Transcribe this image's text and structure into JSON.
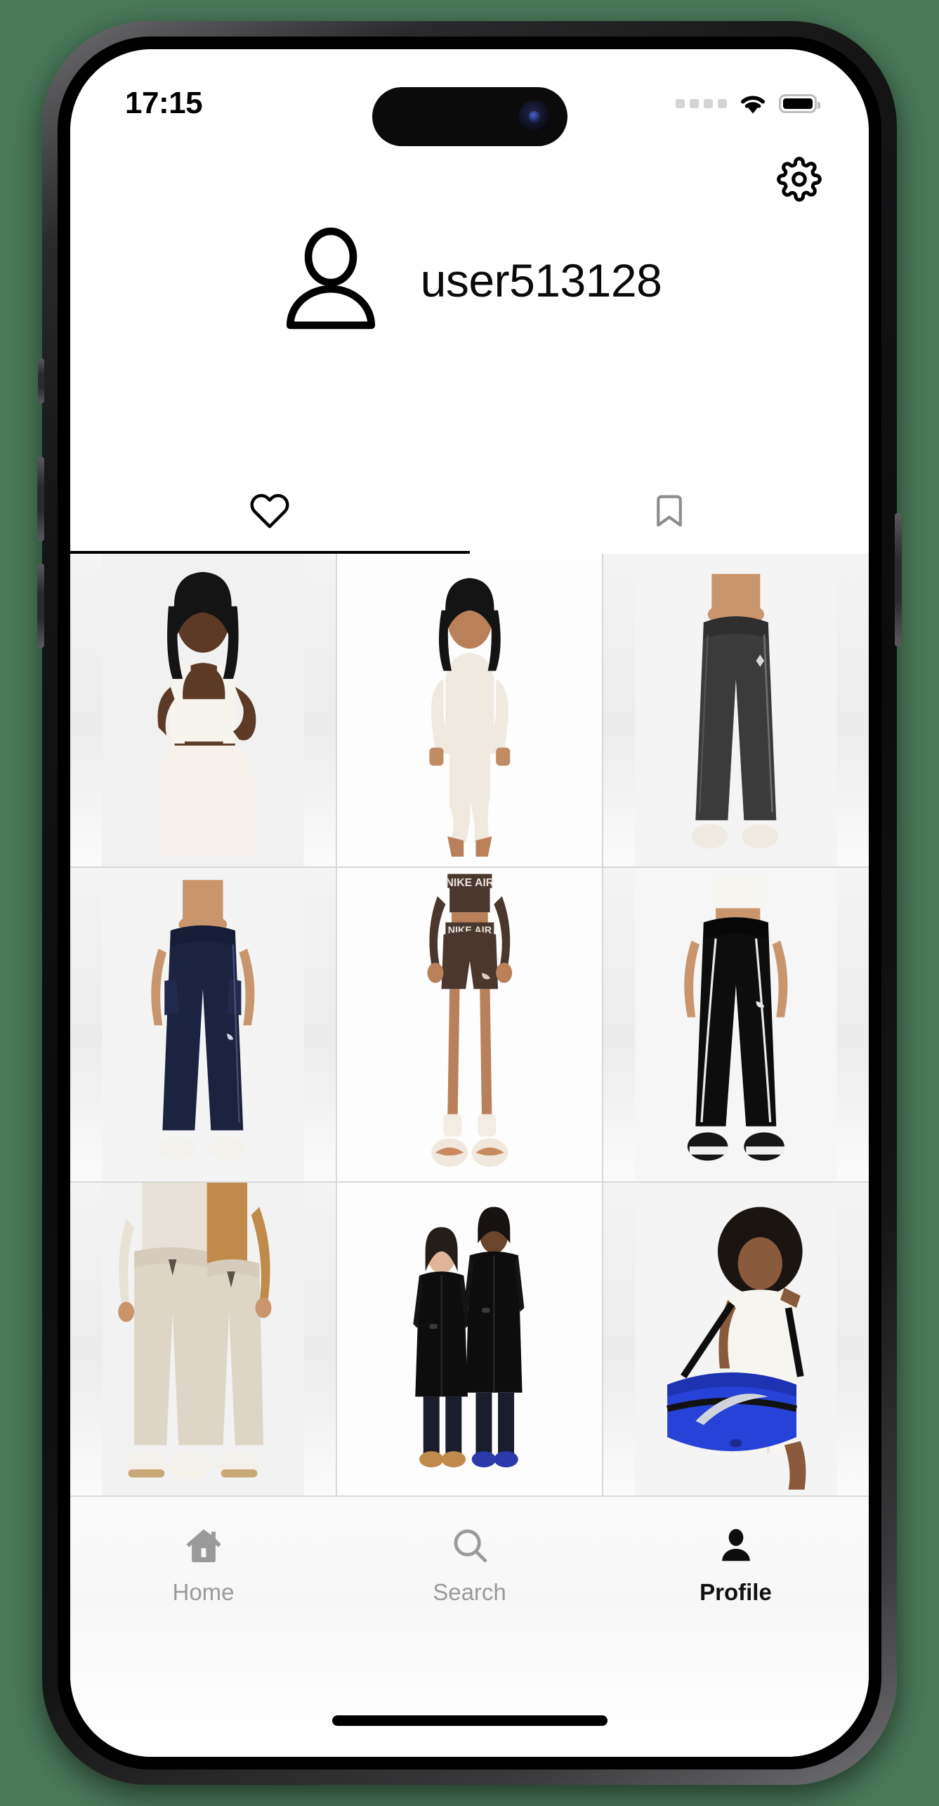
{
  "status_bar": {
    "time": "17:15",
    "signal_icon": "signal-dots-icon",
    "wifi_icon": "wifi-icon",
    "battery_icon": "battery-full-icon",
    "signal_dots": 4
  },
  "header": {
    "settings_icon": "gear-icon",
    "avatar_icon": "person-outline-icon",
    "username": "user513128"
  },
  "content_tabs": [
    {
      "id": "likes",
      "icon": "heart-icon",
      "active": true
    },
    {
      "id": "saved",
      "icon": "bookmark-icon",
      "active": false
    }
  ],
  "product_grid": {
    "columns": 3,
    "items": [
      {
        "id": "item-1",
        "alt": "Woman in white ribbed tank top and white pants",
        "backdrop": "#f1f1f1"
      },
      {
        "id": "item-2",
        "alt": "Woman in cream cropped sweatshirt and shorts set",
        "backdrop": "#fdfdfd"
      },
      {
        "id": "item-3",
        "alt": "Dark grey wide-leg track pants",
        "backdrop": "#f4f4f4"
      },
      {
        "id": "item-4",
        "alt": "Navy blue woven cargo wide-leg pants",
        "backdrop": "#f4f4f4"
      },
      {
        "id": "item-5",
        "alt": "Brown NIKE AIR bike shorts and long-sleeve set",
        "backdrop": "#fdfdfd"
      },
      {
        "id": "item-6",
        "alt": "Black track pants with white piping",
        "backdrop": "#f6f6f6"
      },
      {
        "id": "item-7",
        "alt": "Two models in cream and beige loose trousers",
        "backdrop": "#f2f2f2"
      },
      {
        "id": "item-8",
        "alt": "Two models wearing long black coats",
        "backdrop": "#fdfdfd"
      },
      {
        "id": "item-9",
        "alt": "Woman carrying a blue Nike duffel bag",
        "backdrop": "#f4f4f4"
      }
    ]
  },
  "bottom_nav": {
    "items": [
      {
        "id": "home",
        "label": "Home",
        "icon": "house-icon",
        "active": false
      },
      {
        "id": "search",
        "label": "Search",
        "icon": "magnifier-icon",
        "active": false
      },
      {
        "id": "profile",
        "label": "Profile",
        "icon": "person-filled-icon",
        "active": true
      }
    ]
  },
  "colors": {
    "active": "#000000",
    "inactive": "#9a9a9a",
    "background": "#ffffff",
    "divider": "#dcdcdc"
  }
}
